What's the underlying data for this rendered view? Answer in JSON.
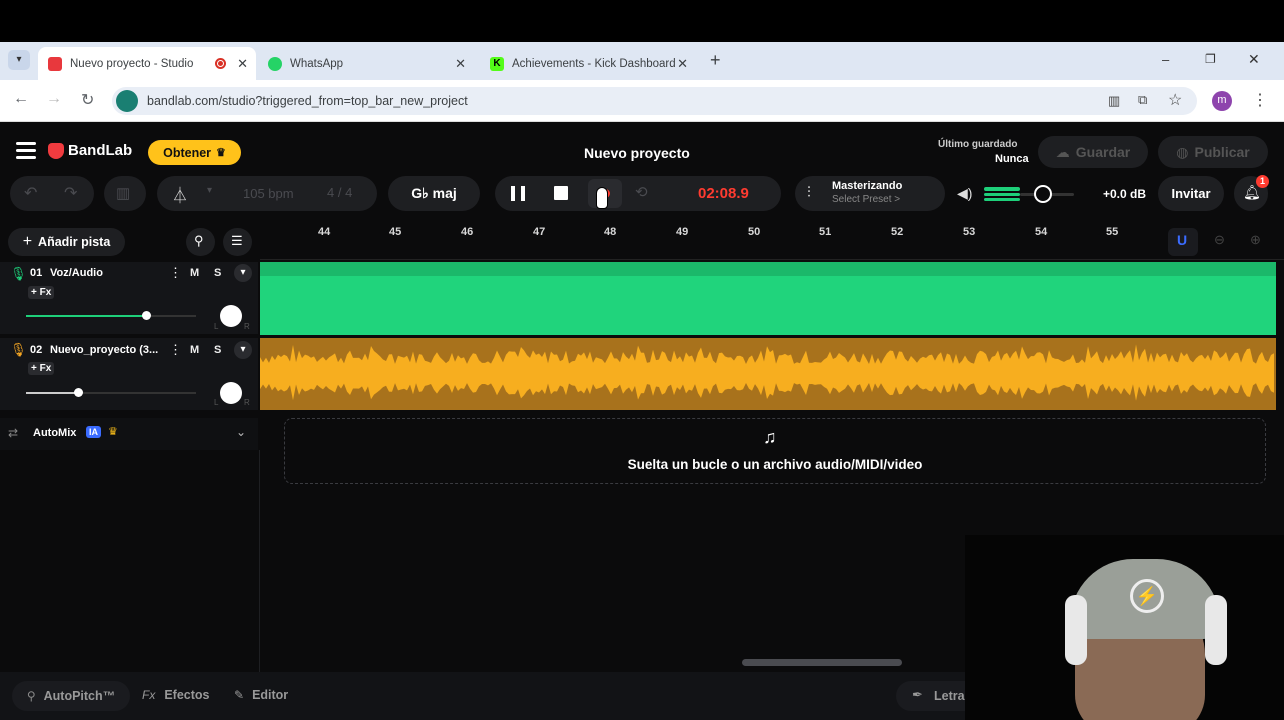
{
  "browser": {
    "tabs": [
      {
        "title": "Nuevo proyecto - Studio",
        "color": "#e8383d",
        "active": true,
        "recording": true
      },
      {
        "title": "WhatsApp",
        "color": "#25d366",
        "active": false
      },
      {
        "title": "Achievements - Kick Dashboard",
        "color": "#53fc18",
        "active": false
      }
    ],
    "new_tab": "+",
    "url": "bandlab.com/studio?triggered_from=top_bar_new_project",
    "profile_initial": "m",
    "window_controls": [
      "–",
      "❐",
      "✕"
    ]
  },
  "header": {
    "brand": "BandLab",
    "get_button": "Obtener",
    "project_title": "Nuevo proyecto",
    "last_saved_label": "Último guardado",
    "last_saved_value": "Nunca",
    "save_button": "Guardar",
    "publish_button": "Publicar"
  },
  "toolbar": {
    "tempo": "105 bpm",
    "time_signature": "4 / 4",
    "key": "G♭ maj",
    "time": "02:08.9",
    "mastering_title": "Masterizando",
    "mastering_preset": "Select Preset >",
    "volume_db": "+0.0 dB",
    "invite_button": "Invitar",
    "notification_count": "1",
    "time_color": "#ff3b30"
  },
  "track_panel": {
    "add_track": "Añadir pista",
    "tracks": [
      {
        "number": "01",
        "name": "Voz/Audio",
        "fx": "+ Fx",
        "mute": "M",
        "solo": "S",
        "color": "#1ed07a",
        "volume": 0.75,
        "pan_l": "L",
        "pan_r": "R"
      },
      {
        "number": "02",
        "name": "Nuevo_proyecto (3...",
        "fx": "+ Fx",
        "mute": "M",
        "solo": "S",
        "color": "#f5a623",
        "volume": 0.3,
        "pan_l": "L",
        "pan_r": "R"
      }
    ],
    "automix": "AutoMix",
    "automix_badge": "IA"
  },
  "timeline": {
    "ruler": [
      "44",
      "45",
      "46",
      "47",
      "48",
      "49",
      "50",
      "51",
      "52",
      "53",
      "54",
      "55"
    ],
    "drop_zone_text": "Suelta un bucle o un archivo audio/MIDI/video"
  },
  "bottom_bar": {
    "autopitch": "AutoPitch™",
    "effects_icon": "Fx",
    "effects": "Efectos",
    "editor": "Editor",
    "lyrics": "Letra"
  }
}
